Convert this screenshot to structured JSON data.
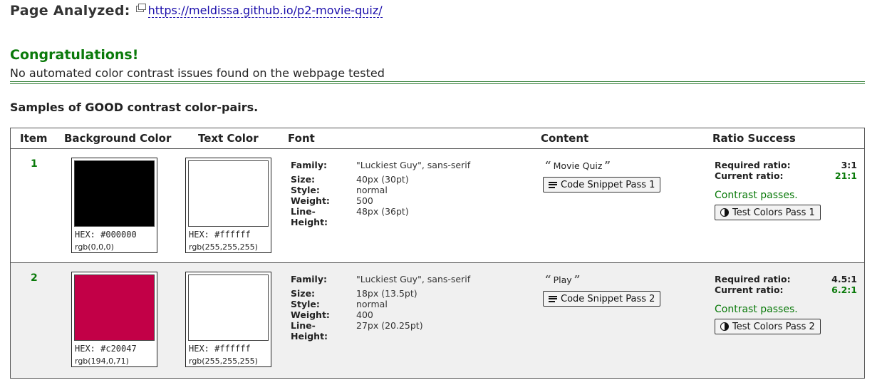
{
  "header": {
    "label": "Page Analyzed:",
    "url": "https://meldissa.github.io/p2-movie-quiz/"
  },
  "result": {
    "title": "Congratulations!",
    "message": "No automated color contrast issues found on the webpage tested"
  },
  "samples_title": "Samples of GOOD contrast color-pairs.",
  "table": {
    "headers": {
      "item": "Item",
      "background": "Background Color",
      "text": "Text Color",
      "font": "Font",
      "content": "Content",
      "ratio": "Ratio Success"
    },
    "font_labels": {
      "family": "Family:",
      "size": "Size:",
      "style": "Style:",
      "weight": "Weight:",
      "line_height": "Line-Height:"
    },
    "ratio_labels": {
      "required": "Required ratio:",
      "current": "Current ratio:"
    },
    "rows": [
      {
        "item": "1",
        "bg": {
          "hex_label": "HEX: #000000",
          "rgb": "rgb(0,0,0)",
          "color": "#000000"
        },
        "fg": {
          "hex_label": "HEX: #ffffff",
          "rgb": "rgb(255,255,255)",
          "color": "#ffffff"
        },
        "font": {
          "family": "\"Luckiest Guy\", sans-serif",
          "size": "40px (30pt)",
          "style": "normal",
          "weight": "500",
          "line_height": "48px (36pt)"
        },
        "content_text": "Movie Quiz",
        "snippet_button": "Code Snippet Pass 1",
        "required_ratio": "3:1",
        "current_ratio": "21:1",
        "status": "Contrast passes.",
        "test_button": "Test Colors Pass 1"
      },
      {
        "item": "2",
        "bg": {
          "hex_label": "HEX: #c20047",
          "rgb": "rgb(194,0,71)",
          "color": "#c20047"
        },
        "fg": {
          "hex_label": "HEX: #ffffff",
          "rgb": "rgb(255,255,255)",
          "color": "#ffffff"
        },
        "font": {
          "family": "\"Luckiest Guy\", sans-serif",
          "size": "18px (13.5pt)",
          "style": "normal",
          "weight": "400",
          "line_height": "27px (20.25pt)"
        },
        "content_text": "Play",
        "snippet_button": "Code Snippet Pass 2",
        "required_ratio": "4.5:1",
        "current_ratio": "6.2:1",
        "status": "Contrast passes.",
        "test_button": "Test Colors Pass 2"
      }
    ]
  },
  "icons": {
    "external_link": "external-link-icon",
    "quote_open": "open-quote-icon",
    "quote_close": "close-quote-icon",
    "snippet": "lines-icon",
    "test_colors": "contrast-icon"
  },
  "colors": {
    "success_green": "#0a7a0a",
    "link_blue": "#1a0dab",
    "row_alt_bg": "#f0f0f0"
  }
}
